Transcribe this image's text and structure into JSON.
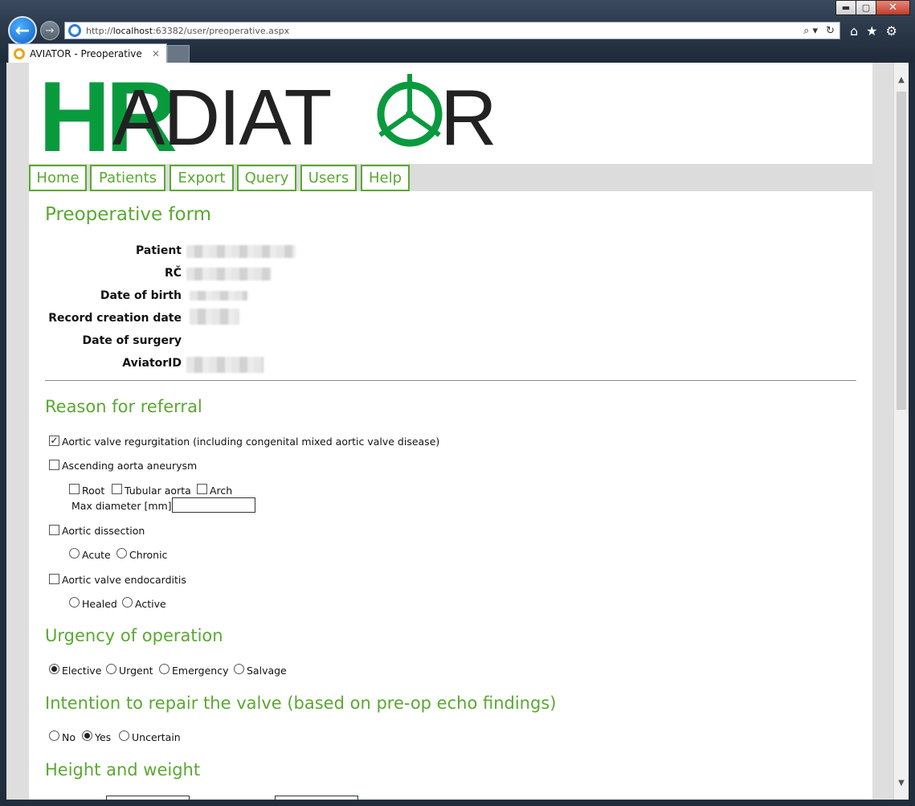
{
  "browser": {
    "url_prefix": "http://",
    "url_host": "localhost",
    "url_rest": ":63382/user/preoperative.aspx",
    "tab_title": "AVIATOR - Preoperative",
    "tab_close": "✕",
    "back_glyph": "←",
    "forward_glyph": "→",
    "window_minimize": "▬",
    "window_maximize": "▢",
    "window_close": "✕",
    "addr_tools": [
      "⌕ ▾",
      "↻"
    ],
    "right_tools": [
      "⌂",
      "★",
      "⚙"
    ]
  },
  "logo": {
    "left": "HR",
    "right_a": "ADIAT",
    "right_b": "R",
    "colors": {
      "green": "#0a9a3e",
      "dark": "#222222"
    }
  },
  "nav": [
    "Home",
    "Patients",
    "Export",
    "Query",
    "Users",
    "Help"
  ],
  "page_title": "Preoperative form",
  "patient_info": {
    "patient_label": "Patient",
    "rc_label": "RČ",
    "dob_label": "Date of birth",
    "created_label": "Record creation date",
    "surgery_label": "Date of surgery",
    "aviator_label": "AviatorID"
  },
  "referral": {
    "heading": "Reason for referral",
    "aortic_regurgitation": {
      "label": "Aortic valve regurgitation (including congenital mixed aortic valve disease)",
      "checked": true
    },
    "aneurysm": {
      "label": "Ascending aorta aneurysm",
      "checked": false
    },
    "root": "Root",
    "tubular": "Tubular aorta",
    "arch": "Arch",
    "max_diameter_label": "Max diameter [mm]",
    "max_diameter_value": "",
    "dissection": {
      "label": "Aortic dissection",
      "checked": false
    },
    "acute": "Acute",
    "chronic": "Chronic",
    "endocarditis": {
      "label": "Aortic valve endocarditis",
      "checked": false
    },
    "healed": "Healed",
    "active": "Active"
  },
  "urgency": {
    "heading": "Urgency of operation",
    "options": [
      "Elective",
      "Urgent",
      "Emergency",
      "Salvage"
    ],
    "selected": "Elective"
  },
  "repair": {
    "heading": "Intention to repair the valve (based on pre-op echo findings)",
    "options": [
      "No",
      "Yes",
      "Uncertain"
    ],
    "selected": "Yes"
  },
  "height_weight": {
    "heading": "Height and weight"
  },
  "scroll": {
    "up": "▲",
    "down": "▼"
  }
}
